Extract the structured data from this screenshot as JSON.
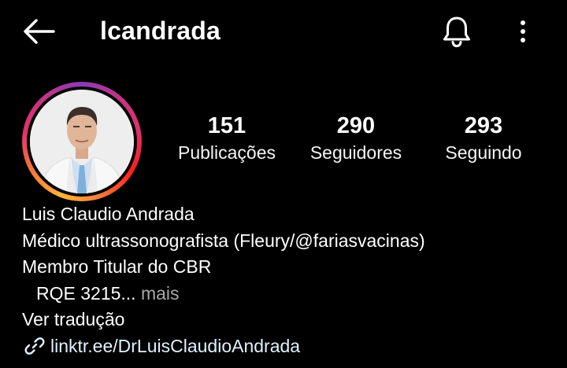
{
  "header": {
    "username": "lcandrada",
    "icons": {
      "back": "arrow-left-icon",
      "bell": "bell-icon",
      "more": "more-vertical-icon"
    }
  },
  "profile": {
    "avatar_icon": "profile-photo",
    "stats": {
      "posts": {
        "value": "151",
        "label": "Publicações"
      },
      "followers": {
        "value": "290",
        "label": "Seguidores"
      },
      "following": {
        "value": "293",
        "label": "Seguindo"
      }
    },
    "bio": {
      "name": "Luis Claudio Andrada",
      "line1": "Médico ultrassonografista (Fleury/@fariasvacinas)",
      "line2": "Membro Titular do CBR",
      "line3": "RQE 3215...",
      "more": " mais",
      "translate": "Ver tradução",
      "link_icon": "link-icon",
      "link": "linktr.ee/DrLuisClaudioAndrada"
    }
  },
  "colors": {
    "background": "#000000",
    "text": "#ffffff",
    "muted": "#a8a8a8",
    "story_ring": [
      "#ffb43b",
      "#e1306c",
      "#8a3ab9"
    ]
  }
}
